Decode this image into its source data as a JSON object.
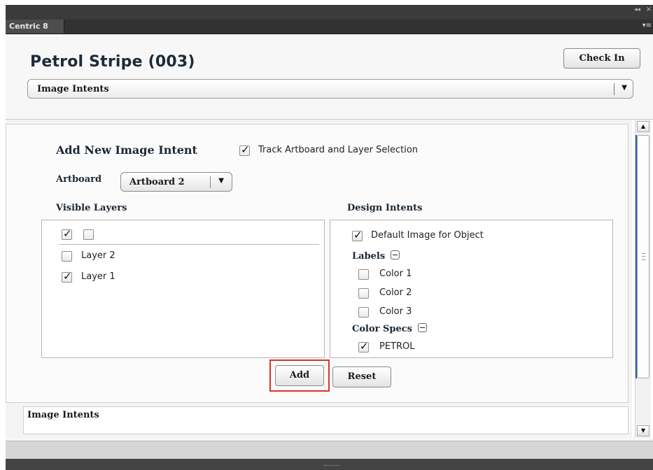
{
  "window": {
    "tab_label": "Centric 8"
  },
  "panel": {
    "title": "Petrol Stripe (003)",
    "check_in_label": "Check In",
    "view_dropdown_value": "Image Intents"
  },
  "form": {
    "heading": "Add New Image Intent",
    "track_label": "Track Artboard and Layer Selection",
    "track_checked": true,
    "artboard_label": "Artboard",
    "artboard_value": "Artboard 2",
    "visible_layers_label": "Visible Layers",
    "design_intents_label": "Design Intents",
    "layers": [
      {
        "label": "Layer 2",
        "checked": false
      },
      {
        "label": "Layer 1",
        "checked": true
      }
    ],
    "design": {
      "default_image_label": "Default Image for Object",
      "labels_heading": "Labels",
      "labels": [
        "Color 1",
        "Color 2",
        "Color 3"
      ],
      "color_specs_heading": "Color Specs",
      "color_specs": [
        "PETROL"
      ]
    },
    "add_label": "Add",
    "reset_label": "Reset"
  },
  "section2": {
    "label": "Image Intents"
  },
  "colors": {
    "highlight": "#e03030",
    "scroll_accent": "#1f5fc8"
  }
}
